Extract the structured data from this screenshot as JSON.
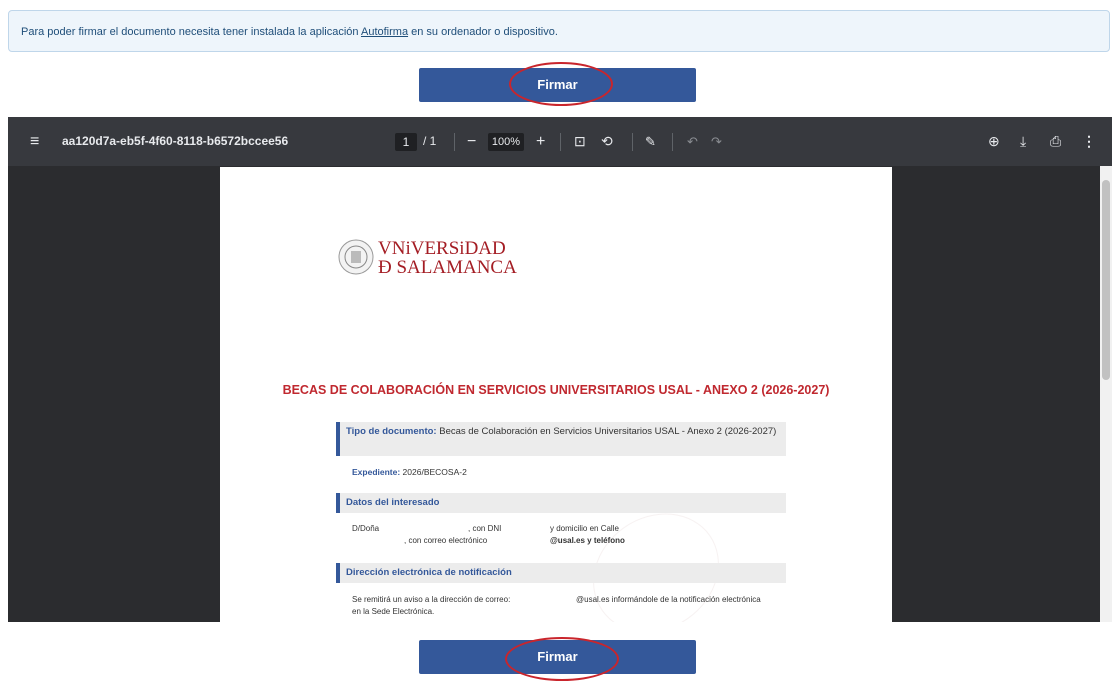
{
  "info_banner": {
    "text_before": "Para poder firmar el documento necesita tener instalada la aplicación ",
    "link": "Autofirma",
    "text_after": " en su ordenador o dispositivo."
  },
  "sign_button_label": "Firmar",
  "viewer": {
    "doc_name": "aa120d7a-eb5f-4f60-8118-b6572bccee56",
    "page_current": "1",
    "page_total": "/ 1",
    "zoom": "100%",
    "icons": [
      "menu-icon",
      "zoom-out-icon",
      "zoom-in-icon",
      "fit-page-icon",
      "rotate-icon",
      "annotate-icon",
      "undo-icon",
      "redo-icon",
      "add-annotation-icon",
      "download-icon",
      "print-icon",
      "more-icon"
    ]
  },
  "document": {
    "logo_line1": "VNiVERSiDAD",
    "logo_line2": "Ð SALAMANCA",
    "title": "BECAS DE COLABORACIÓN EN SERVICIOS UNIVERSITARIOS USAL - ANEXO 2 (2026-2027)",
    "tipo_label": "Tipo de documento:",
    "tipo_value": " Becas de Colaboración en Servicios Universitarios USAL - Anexo 2 (2026-2027)",
    "expediente_label": "Expediente:",
    "expediente_value": " 2026/BECOSA-2",
    "datos_heading": "Datos del interesado",
    "datos_line1_a": "D/Doña",
    "datos_line1_b": ", con DNI",
    "datos_line1_c": "y domicilio en Calle",
    "datos_line2_a": ", con correo electrónico",
    "datos_line2_b": "@usal.es y teléfono",
    "direccion_heading": "Dirección electrónica de notificación",
    "direccion_line1_a": "Se remitirá un aviso a la dirección de correo:",
    "direccion_line1_b": "@usal.es informándole de la notificación electrónica",
    "direccion_line2": "en la Sede Electrónica."
  }
}
